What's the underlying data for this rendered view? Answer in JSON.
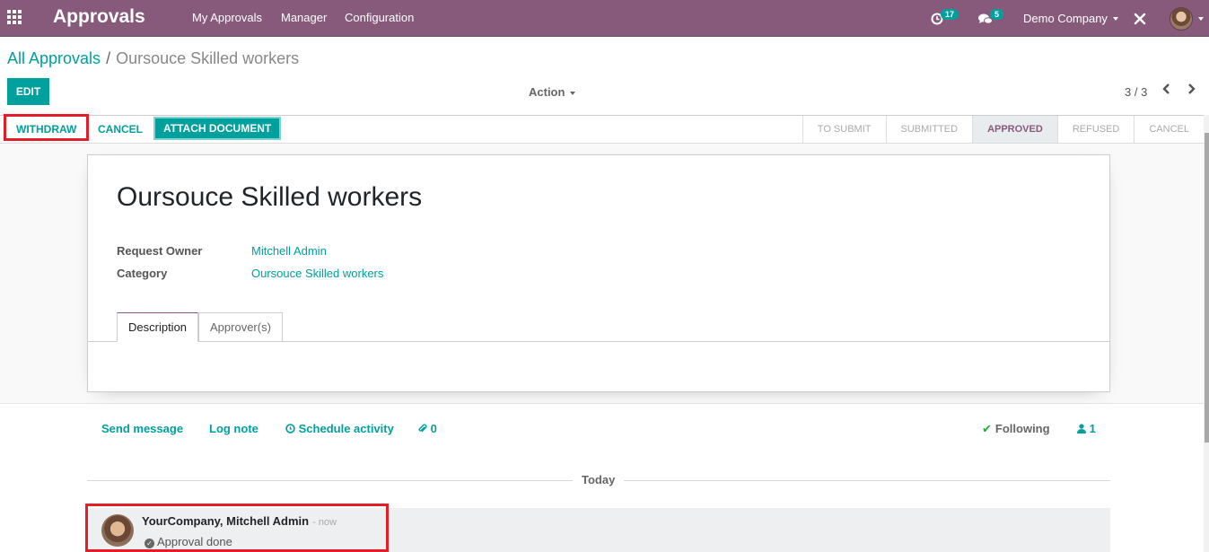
{
  "navbar": {
    "app_name": "Approvals",
    "menus": [
      "My Approvals",
      "Manager",
      "Configuration"
    ],
    "activity_count": "17",
    "message_count": "5",
    "company": "Demo Company",
    "icons": {
      "apps": "apps-grid-icon",
      "activity": "clock-icon",
      "messages": "chat-bubbles-icon",
      "debug": "tools-icon"
    }
  },
  "breadcrumb": {
    "parent": "All Approvals",
    "separator": "/",
    "current": "Oursouce Skilled workers"
  },
  "toolbar": {
    "edit_label": "EDIT",
    "action_label": "Action",
    "pager": "3 / 3"
  },
  "statusbar": {
    "buttons": [
      "WITHDRAW",
      "CANCEL",
      "ATTACH DOCUMENT"
    ],
    "stages": [
      "TO SUBMIT",
      "SUBMITTED",
      "APPROVED",
      "REFUSED",
      "CANCEL"
    ],
    "active_stage": "APPROVED"
  },
  "form": {
    "title": "Oursouce Skilled workers",
    "fields": [
      {
        "label": "Request Owner",
        "value": "Mitchell Admin"
      },
      {
        "label": "Category",
        "value": "Oursouce Skilled workers"
      }
    ],
    "tabs": [
      "Description",
      "Approver(s)"
    ],
    "active_tab": "Description"
  },
  "chatter": {
    "send_message": "Send message",
    "log_note": "Log note",
    "schedule_activity": "Schedule activity",
    "attachments_count": "0",
    "following": "Following",
    "followers_count": "1",
    "date_separator": "Today",
    "messages": [
      {
        "author": "YourCompany, Mitchell Admin",
        "date": "- now",
        "body": "Approval done"
      }
    ]
  },
  "colors": {
    "brand": "#875a7b",
    "accent": "#00a09d",
    "highlight": "#e41d2b"
  }
}
